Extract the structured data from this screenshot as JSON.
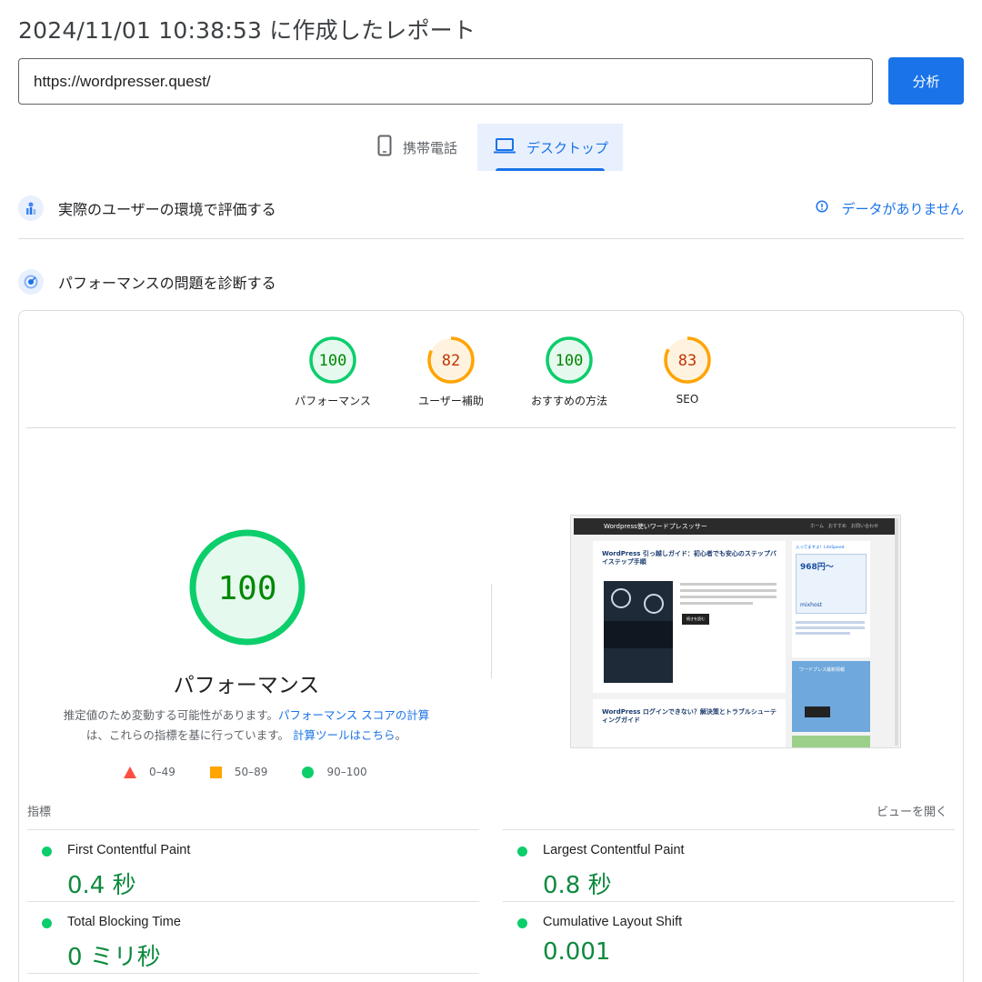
{
  "report": {
    "title": "2024/11/01 10:38:53 に作成したレポート"
  },
  "search": {
    "url_value": "https://wordpresser.quest/",
    "analyze_label": "分析"
  },
  "device_tabs": [
    {
      "label": "携帯電話",
      "icon": "smartphone-icon",
      "selected": false
    },
    {
      "label": "デスクトップ",
      "icon": "laptop-icon",
      "selected": true
    }
  ],
  "field_data": {
    "title": "実際のユーザーの環境で評価する",
    "no_data_label": "データがありません"
  },
  "lab": {
    "title": "パフォーマンスの問題を診断する"
  },
  "categories": [
    {
      "label": "パフォーマンス",
      "score": "100",
      "status": "pass"
    },
    {
      "label": "ユーザー補助",
      "score": "82",
      "status": "average"
    },
    {
      "label": "おすすめの方法",
      "score": "100",
      "status": "pass"
    },
    {
      "label": "SEO",
      "score": "83",
      "status": "average"
    }
  ],
  "performance": {
    "score": "100",
    "label": "パフォーマンス",
    "note_pre": "推定値のため変動する可能性があります。",
    "note_link1": "パフォーマンス スコアの計算",
    "note_mid": "は、これらの指標を基に行っています。",
    "note_link2": "計算ツールはこちら",
    "note_post": "。"
  },
  "legend": [
    {
      "range": "0–49",
      "shape": "triangle",
      "color": "#ff4e42"
    },
    {
      "range": "50–89",
      "shape": "square",
      "color": "#ffa400"
    },
    {
      "range": "90–100",
      "shape": "circle",
      "color": "#0cce6b"
    }
  ],
  "screenshot": {
    "site_title": "Wordpress使いワードプレスッサー",
    "nav": "ホーム　おすすめ　お問い合わせ",
    "post1_title": "WordPress 引っ越しガイド：初心者でも安心のステップバイステップ手順",
    "post2_title": "WordPress ログインできない？解決策とトラブルシューティングガイド",
    "side_head": "入ってますよ！LiteSpeed",
    "side_price": "968円〜",
    "side_brand": "mixhost",
    "side_box_title": "ワードプレス最新情報",
    "read_more": "続きを読む"
  },
  "metrics": {
    "header": "指標",
    "expand_label": "ビューを開く",
    "items": [
      {
        "name": "First Contentful Paint",
        "value": "0.4 秒"
      },
      {
        "name": "Largest Contentful Paint",
        "value": "0.8 秒"
      },
      {
        "name": "Total Blocking Time",
        "value": "0 ミリ秒"
      },
      {
        "name": "Cumulative Layout Shift",
        "value": "0.001"
      }
    ]
  },
  "colors": {
    "accent": "#1a73e8",
    "pass": "#0cce6b",
    "pass_text": "#008800",
    "average": "#ffa400",
    "average_text": "#c33300",
    "fail": "#ff4e42"
  }
}
